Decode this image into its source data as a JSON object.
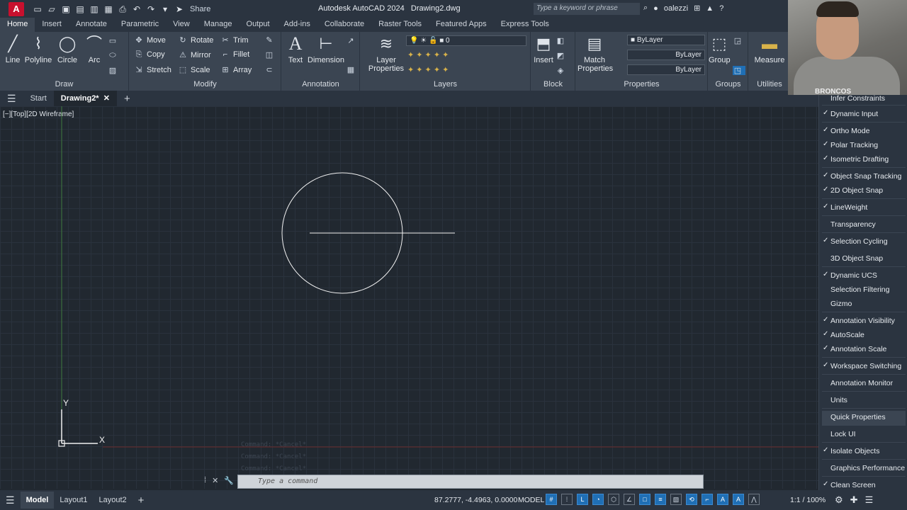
{
  "app": {
    "logo": "A",
    "title": "Autodesk AutoCAD 2024",
    "file": "Drawing2.dwg",
    "share_label": "Share",
    "search_placeholder": "Type a keyword or phrase",
    "user": "oalezzi"
  },
  "ribbon_tabs": [
    "Home",
    "Insert",
    "Annotate",
    "Parametric",
    "View",
    "Manage",
    "Output",
    "Add-ins",
    "Collaborate",
    "Raster Tools",
    "Featured Apps",
    "Express Tools"
  ],
  "ribbon": {
    "draw": {
      "title": "Draw",
      "tools": [
        "Line",
        "Polyline",
        "Circle",
        "Arc"
      ]
    },
    "modify": {
      "title": "Modify",
      "tools": [
        "Move",
        "Rotate",
        "Trim",
        "Copy",
        "Mirror",
        "Fillet",
        "Stretch",
        "Scale",
        "Array"
      ]
    },
    "annotation": {
      "title": "Annotation",
      "tools": [
        "Text",
        "Dimension"
      ]
    },
    "layers": {
      "title": "Layers",
      "tool": "Layer Properties",
      "current_layer": "0"
    },
    "block": {
      "title": "Block",
      "tool": "Insert"
    },
    "properties": {
      "title": "Properties",
      "tool": "Match Properties",
      "color": "ByLayer",
      "linetype": "ByLayer",
      "lineweight": "ByLayer"
    },
    "groups": {
      "title": "Groups",
      "tool": "Group"
    },
    "utilities": {
      "title": "Utilities",
      "tool": "Measure"
    }
  },
  "file_tabs": {
    "start": "Start",
    "drawing": "Drawing2*"
  },
  "viewport": {
    "label": "[−][Top][2D Wireframe]"
  },
  "command": {
    "placeholder": "Type a command",
    "history": [
      "Command: *Cancel*",
      "Command: *Cancel*",
      "Command: *Cancel*"
    ]
  },
  "status": {
    "model_tab": "Model",
    "layout1": "Layout1",
    "layout2": "Layout2",
    "coords": "87.2777, -4.4963, 0.0000",
    "model_button": "MODEL",
    "zoom": "1:1 / 100%"
  },
  "custom_menu": [
    {
      "label": "Infer Constraints",
      "checked": false
    },
    {
      "label": "Dynamic Input",
      "checked": true
    },
    {
      "label": "Ortho Mode",
      "checked": true
    },
    {
      "label": "Polar Tracking",
      "checked": true
    },
    {
      "label": "Isometric Drafting",
      "checked": true
    },
    {
      "label": "Object Snap Tracking",
      "checked": true
    },
    {
      "label": "2D Object Snap",
      "checked": true
    },
    {
      "label": "LineWeight",
      "checked": true
    },
    {
      "label": "Transparency",
      "checked": false
    },
    {
      "label": "Selection Cycling",
      "checked": true
    },
    {
      "label": "3D Object Snap",
      "checked": false
    },
    {
      "label": "Dynamic UCS",
      "checked": true
    },
    {
      "label": "Selection Filtering",
      "checked": false
    },
    {
      "label": "Gizmo",
      "checked": false
    },
    {
      "label": "Annotation Visibility",
      "checked": true
    },
    {
      "label": "AutoScale",
      "checked": true
    },
    {
      "label": "Annotation Scale",
      "checked": true
    },
    {
      "label": "Workspace Switching",
      "checked": true
    },
    {
      "label": "Annotation Monitor",
      "checked": false
    },
    {
      "label": "Units",
      "checked": false
    },
    {
      "label": "Quick Properties",
      "checked": false
    },
    {
      "label": "Lock UI",
      "checked": false
    },
    {
      "label": "Isolate Objects",
      "checked": true
    },
    {
      "label": "Graphics Performance",
      "checked": false
    },
    {
      "label": "Clean Screen",
      "checked": true
    }
  ],
  "webcam": {
    "shirt_text": "BRONCOS"
  },
  "colors": {
    "accent": "#1f6fb5",
    "background": "#212830",
    "ribbon": "#3b4552"
  }
}
